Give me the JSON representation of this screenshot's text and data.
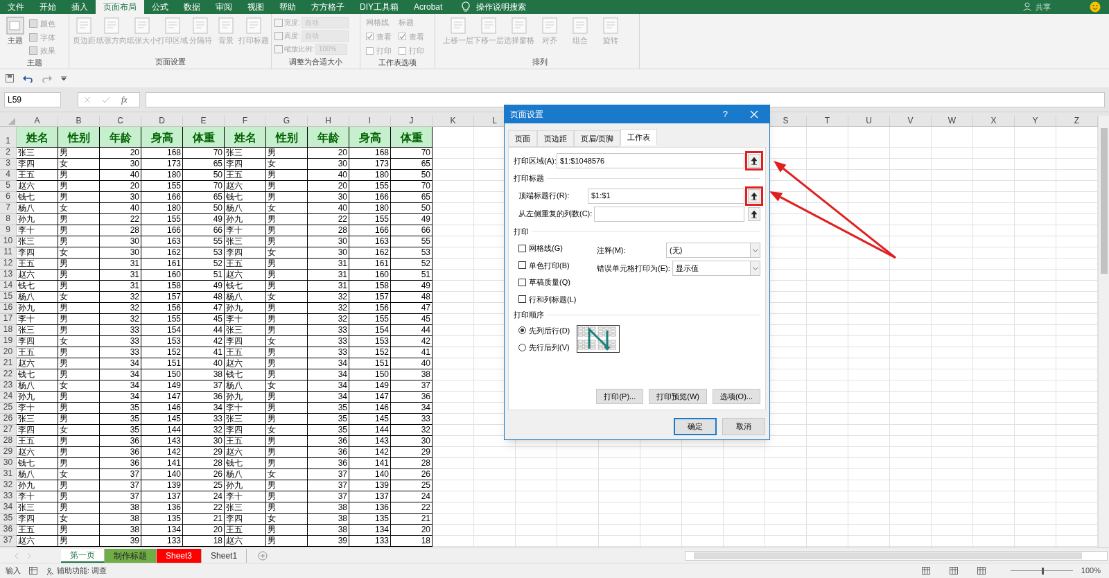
{
  "menu_tabs": [
    {
      "label": "文件",
      "selected": false
    },
    {
      "label": "开始",
      "selected": false
    },
    {
      "label": "插入",
      "selected": false
    },
    {
      "label": "页面布局",
      "selected": true
    },
    {
      "label": "公式",
      "selected": false
    },
    {
      "label": "数据",
      "selected": false
    },
    {
      "label": "审阅",
      "selected": false
    },
    {
      "label": "视图",
      "selected": false
    },
    {
      "label": "帮助",
      "selected": false
    },
    {
      "label": "方方格子",
      "selected": false
    },
    {
      "label": "DIY工具箱",
      "selected": false
    },
    {
      "label": "Acrobat",
      "selected": false
    }
  ],
  "search_hint": "操作说明搜索",
  "share": "共享",
  "ribbon": {
    "theme_group": {
      "label": "主题",
      "big": "主题",
      "small": [
        "颜色",
        "字体",
        "效果"
      ]
    },
    "page_setup_group": {
      "label": "页面设置",
      "buttons": [
        "页边距",
        "纸张方向",
        "纸张大小",
        "打印区域",
        "分隔符",
        "背景",
        "打印标题"
      ]
    },
    "scale_group": {
      "label": "调整为合适大小",
      "width_label": "宽度:",
      "width_value": "自动",
      "height_label": "高度:",
      "height_value": "自动",
      "scale_label": "缩放比例:",
      "scale_value": "100%"
    },
    "sheet_options_group": {
      "label": "工作表选项",
      "columns": [
        {
          "title": "网格线",
          "view": "查看",
          "view_checked": true,
          "print": "打印",
          "print_checked": false
        },
        {
          "title": "标题",
          "view": "查看",
          "view_checked": true,
          "print": "打印",
          "print_checked": false
        }
      ]
    },
    "arrange_group": {
      "label": "排列",
      "buttons": [
        "上移一层",
        "下移一层",
        "选择窗格",
        "对齐",
        "组合",
        "旋转"
      ]
    }
  },
  "name_box": "L59",
  "fx": "fx",
  "sheet": {
    "columns_left": [
      "A",
      "B",
      "C",
      "D",
      "E",
      "F",
      "G",
      "H",
      "I",
      "J",
      "K",
      "L"
    ],
    "columns_right": [
      "S",
      "T",
      "U",
      "V",
      "W",
      "X",
      "Y",
      "Z"
    ],
    "header": {
      "n": "1",
      "cells": [
        "姓名",
        "性别",
        "年龄",
        "身高",
        "体重",
        "姓名",
        "性别",
        "年龄",
        "身高",
        "体重"
      ]
    },
    "rows": [
      {
        "n": "2",
        "cells": [
          "张三",
          "男",
          "20",
          "168",
          "70",
          "张三",
          "男",
          "20",
          "168",
          "70"
        ]
      },
      {
        "n": "3",
        "cells": [
          "李四",
          "女",
          "30",
          "173",
          "65",
          "李四",
          "女",
          "30",
          "173",
          "65"
        ]
      },
      {
        "n": "4",
        "cells": [
          "王五",
          "男",
          "40",
          "180",
          "50",
          "王五",
          "男",
          "40",
          "180",
          "50"
        ]
      },
      {
        "n": "5",
        "cells": [
          "赵六",
          "男",
          "20",
          "155",
          "70",
          "赵六",
          "男",
          "20",
          "155",
          "70"
        ]
      },
      {
        "n": "6",
        "cells": [
          "钱七",
          "男",
          "30",
          "166",
          "65",
          "钱七",
          "男",
          "30",
          "166",
          "65"
        ]
      },
      {
        "n": "7",
        "cells": [
          "杨八",
          "女",
          "40",
          "180",
          "50",
          "杨八",
          "女",
          "40",
          "180",
          "50"
        ]
      },
      {
        "n": "8",
        "cells": [
          "孙九",
          "男",
          "22",
          "155",
          "49",
          "孙九",
          "男",
          "22",
          "155",
          "49"
        ]
      },
      {
        "n": "9",
        "cells": [
          "李十",
          "男",
          "28",
          "166",
          "66",
          "李十",
          "男",
          "28",
          "166",
          "66"
        ]
      },
      {
        "n": "10",
        "cells": [
          "张三",
          "男",
          "30",
          "163",
          "55",
          "张三",
          "男",
          "30",
          "163",
          "55"
        ]
      },
      {
        "n": "11",
        "cells": [
          "李四",
          "女",
          "30",
          "162",
          "53",
          "李四",
          "女",
          "30",
          "162",
          "53"
        ]
      },
      {
        "n": "12",
        "cells": [
          "王五",
          "男",
          "31",
          "161",
          "52",
          "王五",
          "男",
          "31",
          "161",
          "52"
        ]
      },
      {
        "n": "13",
        "cells": [
          "赵六",
          "男",
          "31",
          "160",
          "51",
          "赵六",
          "男",
          "31",
          "160",
          "51"
        ]
      },
      {
        "n": "14",
        "cells": [
          "钱七",
          "男",
          "31",
          "158",
          "49",
          "钱七",
          "男",
          "31",
          "158",
          "49"
        ]
      },
      {
        "n": "15",
        "cells": [
          "杨八",
          "女",
          "32",
          "157",
          "48",
          "杨八",
          "女",
          "32",
          "157",
          "48"
        ]
      },
      {
        "n": "16",
        "cells": [
          "孙九",
          "男",
          "32",
          "156",
          "47",
          "孙九",
          "男",
          "32",
          "156",
          "47"
        ]
      },
      {
        "n": "17",
        "cells": [
          "李十",
          "男",
          "32",
          "155",
          "45",
          "李十",
          "男",
          "32",
          "155",
          "45"
        ]
      },
      {
        "n": "18",
        "cells": [
          "张三",
          "男",
          "33",
          "154",
          "44",
          "张三",
          "男",
          "33",
          "154",
          "44"
        ]
      },
      {
        "n": "19",
        "cells": [
          "李四",
          "女",
          "33",
          "153",
          "42",
          "李四",
          "女",
          "33",
          "153",
          "42"
        ]
      },
      {
        "n": "20",
        "cells": [
          "王五",
          "男",
          "33",
          "152",
          "41",
          "王五",
          "男",
          "33",
          "152",
          "41"
        ]
      },
      {
        "n": "21",
        "cells": [
          "赵六",
          "男",
          "34",
          "151",
          "40",
          "赵六",
          "男",
          "34",
          "151",
          "40"
        ]
      },
      {
        "n": "22",
        "cells": [
          "钱七",
          "男",
          "34",
          "150",
          "38",
          "钱七",
          "男",
          "34",
          "150",
          "38"
        ]
      },
      {
        "n": "23",
        "cells": [
          "杨八",
          "女",
          "34",
          "149",
          "37",
          "杨八",
          "女",
          "34",
          "149",
          "37"
        ]
      },
      {
        "n": "24",
        "cells": [
          "孙九",
          "男",
          "34",
          "147",
          "36",
          "孙九",
          "男",
          "34",
          "147",
          "36"
        ]
      },
      {
        "n": "25",
        "cells": [
          "李十",
          "男",
          "35",
          "146",
          "34",
          "李十",
          "男",
          "35",
          "146",
          "34"
        ]
      },
      {
        "n": "26",
        "cells": [
          "张三",
          "男",
          "35",
          "145",
          "33",
          "张三",
          "男",
          "35",
          "145",
          "33"
        ]
      },
      {
        "n": "27",
        "cells": [
          "李四",
          "女",
          "35",
          "144",
          "32",
          "李四",
          "女",
          "35",
          "144",
          "32"
        ]
      },
      {
        "n": "28",
        "cells": [
          "王五",
          "男",
          "36",
          "143",
          "30",
          "王五",
          "男",
          "36",
          "143",
          "30"
        ]
      },
      {
        "n": "29",
        "cells": [
          "赵六",
          "男",
          "36",
          "142",
          "29",
          "赵六",
          "男",
          "36",
          "142",
          "29"
        ]
      },
      {
        "n": "30",
        "cells": [
          "钱七",
          "男",
          "36",
          "141",
          "28",
          "钱七",
          "男",
          "36",
          "141",
          "28"
        ]
      },
      {
        "n": "31",
        "cells": [
          "杨八",
          "女",
          "37",
          "140",
          "26",
          "杨八",
          "女",
          "37",
          "140",
          "26"
        ]
      },
      {
        "n": "32",
        "cells": [
          "孙九",
          "男",
          "37",
          "139",
          "25",
          "孙九",
          "男",
          "37",
          "139",
          "25"
        ]
      },
      {
        "n": "33",
        "cells": [
          "李十",
          "男",
          "37",
          "137",
          "24",
          "李十",
          "男",
          "37",
          "137",
          "24"
        ]
      },
      {
        "n": "34",
        "cells": [
          "张三",
          "男",
          "38",
          "136",
          "22",
          "张三",
          "男",
          "38",
          "136",
          "22"
        ]
      },
      {
        "n": "35",
        "cells": [
          "李四",
          "女",
          "38",
          "135",
          "21",
          "李四",
          "女",
          "38",
          "135",
          "21"
        ]
      },
      {
        "n": "36",
        "cells": [
          "王五",
          "男",
          "38",
          "134",
          "20",
          "王五",
          "男",
          "38",
          "134",
          "20"
        ]
      },
      {
        "n": "37",
        "cells": [
          "赵六",
          "男",
          "39",
          "133",
          "18",
          "赵六",
          "男",
          "39",
          "133",
          "18"
        ]
      }
    ]
  },
  "sheet_tabs": [
    {
      "label": "第一页",
      "selected": true
    },
    {
      "label": "制作标题",
      "selected": false,
      "color": "#70ad47"
    },
    {
      "label": "Sheet3",
      "selected": false,
      "color": "#ff0000"
    },
    {
      "label": "Sheet1",
      "selected": false
    }
  ],
  "status_bar": {
    "mode": "输入",
    "accessibility": "辅助功能: 调查",
    "zoom": "100%",
    "zoom_slider": {
      "level": 0.5
    }
  },
  "dialog": {
    "title": "页面设置",
    "help": "?",
    "tabs": [
      {
        "label": "页面",
        "selected": false
      },
      {
        "label": "页边距",
        "selected": false
      },
      {
        "label": "页眉/页脚",
        "selected": false
      },
      {
        "label": "工作表",
        "selected": true
      }
    ],
    "print_area": {
      "label": "打印区域(A):",
      "value": "$1:$1048576",
      "highlighted": true
    },
    "print_titles_heading": "打印标题",
    "title_fields": [
      {
        "label": "顶端标题行(R):",
        "value": "$1:$1",
        "highlighted": true
      },
      {
        "label": "从左侧重复的列数(C):",
        "highlighted": false
      }
    ],
    "print_heading": "打印",
    "print_options": [
      {
        "label": "网格线(G)",
        "checked": false
      },
      {
        "label": "单色打印(B)",
        "checked": false
      },
      {
        "label": "草稿质量(Q)",
        "checked": false
      },
      {
        "label": "行和列标题(L)",
        "checked": false
      }
    ],
    "dropdowns": [
      {
        "label": "注释(M):",
        "value": "(无)"
      },
      {
        "label": "错误单元格打印为(E):",
        "value": "显示值"
      }
    ],
    "order_heading": "打印顺序",
    "order_options": [
      {
        "label": "先列后行(D)",
        "selected": true
      },
      {
        "label": "先行后列(V)",
        "selected": false
      }
    ],
    "buttons": [
      "打印(P)...",
      "打印预览(W)",
      "选项(O)..."
    ],
    "ok": "确定",
    "cancel": "取消"
  }
}
